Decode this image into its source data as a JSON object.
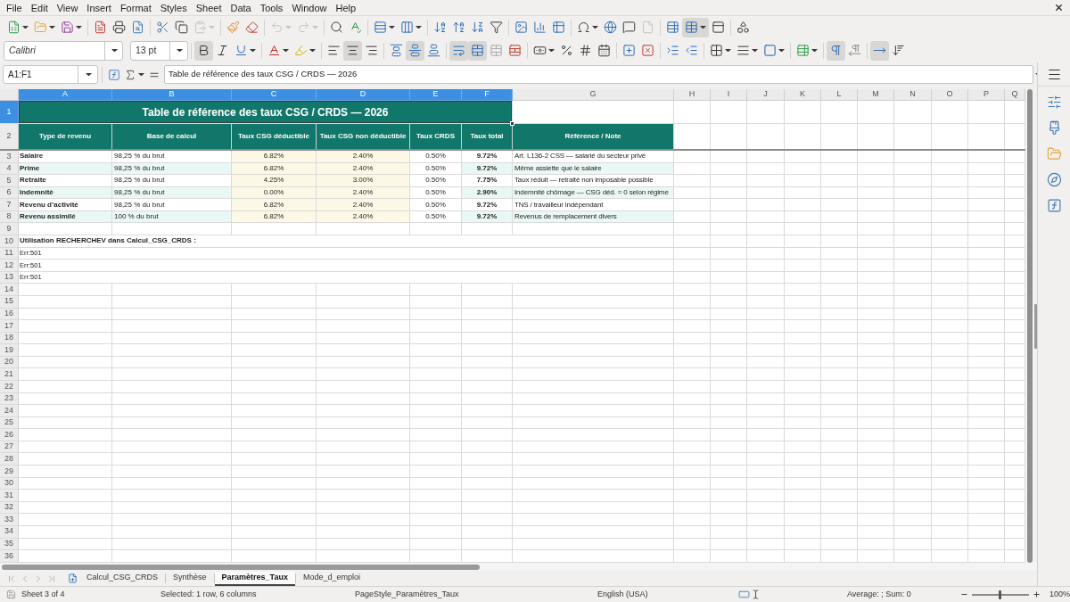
{
  "menu_bar": {
    "items": [
      "File",
      "Edit",
      "View",
      "Insert",
      "Format",
      "Styles",
      "Sheet",
      "Data",
      "Tools",
      "Window",
      "Help"
    ]
  },
  "standard_toolbar": {
    "buttons": [
      {
        "pressed": false,
        "disabled": false
      },
      {
        "pressed": false,
        "disabled": false
      },
      {
        "pressed": false,
        "disabled": false
      },
      {
        "pressed": false,
        "disabled": false
      },
      {
        "pressed": false,
        "disabled": false
      },
      {
        "pressed": false,
        "disabled": false
      },
      {
        "pressed": false,
        "disabled": false
      },
      {
        "pressed": false,
        "disabled": false
      },
      {
        "pressed": false,
        "disabled": true
      },
      {
        "pressed": false,
        "disabled": false
      },
      {
        "pressed": false,
        "disabled": false
      },
      {
        "pressed": false,
        "disabled": true
      },
      {
        "pressed": false,
        "disabled": true
      },
      {
        "pressed": false,
        "disabled": false
      },
      {
        "pressed": false,
        "disabled": false
      },
      {
        "pressed": false,
        "disabled": false
      },
      {
        "pressed": false,
        "disabled": false
      },
      {
        "pressed": false,
        "disabled": false
      },
      {
        "pressed": false,
        "disabled": false
      },
      {
        "pressed": false,
        "disabled": false
      },
      {
        "pressed": false,
        "disabled": false
      },
      {
        "pressed": false,
        "disabled": false
      },
      {
        "pressed": false,
        "disabled": false
      },
      {
        "pressed": false,
        "disabled": false
      },
      {
        "pressed": false,
        "disabled": false
      },
      {
        "pressed": false,
        "disabled": false
      },
      {
        "pressed": false,
        "disabled": false
      },
      {
        "pressed": false,
        "disabled": true
      },
      {
        "pressed": false,
        "disabled": false
      },
      {
        "pressed": true,
        "disabled": false
      },
      {
        "pressed": false,
        "disabled": false
      },
      {
        "pressed": false,
        "disabled": false
      }
    ]
  },
  "formatting_toolbar": {
    "font_name": "Calibri",
    "font_size": "13 pt",
    "buttons": [
      {
        "pressed": true
      },
      {
        "pressed": false
      },
      {
        "pressed": false
      },
      {
        "pressed": false
      },
      {
        "pressed": false
      },
      {
        "pressed": false
      },
      {
        "pressed": true
      },
      {
        "pressed": false
      },
      {
        "pressed": false
      },
      {
        "pressed": true
      },
      {
        "pressed": false
      },
      {
        "pressed": true
      },
      {
        "pressed": true
      },
      {
        "pressed": false
      },
      {
        "pressed": false
      },
      {
        "pressed": false
      },
      {
        "pressed": false
      },
      {
        "pressed": false
      },
      {
        "pressed": false
      },
      {
        "pressed": false
      },
      {
        "pressed": false
      },
      {
        "pressed": false
      },
      {
        "pressed": false
      },
      {
        "pressed": false
      },
      {
        "pressed": false
      },
      {
        "pressed": false
      },
      {
        "pressed": false
      },
      {
        "pressed": true
      },
      {
        "pressed": false
      },
      {
        "pressed": true
      },
      {
        "pressed": false
      }
    ]
  },
  "formula_bar": {
    "cell_reference": "A1:F1",
    "content": "Table de référence des taux CSG / CRDS — 2026"
  },
  "sheet": {
    "columns": [
      {
        "label": "A",
        "selected": true
      },
      {
        "label": "B",
        "selected": true
      },
      {
        "label": "C",
        "selected": true
      },
      {
        "label": "D",
        "selected": true
      },
      {
        "label": "E",
        "selected": true
      },
      {
        "label": "F",
        "selected": true
      },
      {
        "label": "G",
        "selected": false
      },
      {
        "label": "H",
        "selected": false
      },
      {
        "label": "I",
        "selected": false
      },
      {
        "label": "J",
        "selected": false
      },
      {
        "label": "K",
        "selected": false
      },
      {
        "label": "L",
        "selected": false
      },
      {
        "label": "M",
        "selected": false
      },
      {
        "label": "N",
        "selected": false
      },
      {
        "label": "O",
        "selected": false
      },
      {
        "label": "P",
        "selected": false
      },
      {
        "label": "Q",
        "selected": false
      }
    ],
    "rows": [
      {
        "label": "1",
        "selected": true
      },
      {
        "label": "2",
        "selected": false
      },
      {
        "label": "3",
        "selected": false
      },
      {
        "label": "4",
        "selected": false
      },
      {
        "label": "5",
        "selected": false
      },
      {
        "label": "6",
        "selected": false
      },
      {
        "label": "7",
        "selected": false
      },
      {
        "label": "8",
        "selected": false
      },
      {
        "label": "9",
        "selected": false
      },
      {
        "label": "10",
        "selected": false
      },
      {
        "label": "11",
        "selected": false
      },
      {
        "label": "12",
        "selected": false
      },
      {
        "label": "13",
        "selected": false
      },
      {
        "label": "14",
        "selected": false
      },
      {
        "label": "15",
        "selected": false
      },
      {
        "label": "16",
        "selected": false
      },
      {
        "label": "17",
        "selected": false
      },
      {
        "label": "18",
        "selected": false
      },
      {
        "label": "19",
        "selected": false
      },
      {
        "label": "20",
        "selected": false
      },
      {
        "label": "21",
        "selected": false
      },
      {
        "label": "22",
        "selected": false
      },
      {
        "label": "23",
        "selected": false
      },
      {
        "label": "24",
        "selected": false
      },
      {
        "label": "25",
        "selected": false
      },
      {
        "label": "26",
        "selected": false
      },
      {
        "label": "27",
        "selected": false
      },
      {
        "label": "28",
        "selected": false
      },
      {
        "label": "29",
        "selected": false
      },
      {
        "label": "30",
        "selected": false
      },
      {
        "label": "31",
        "selected": false
      },
      {
        "label": "32",
        "selected": false
      },
      {
        "label": "33",
        "selected": false
      },
      {
        "label": "34",
        "selected": false
      },
      {
        "label": "35",
        "selected": false
      },
      {
        "label": "36",
        "selected": false
      }
    ],
    "title": "Table de référence des taux CSG / CRDS — 2026",
    "table": {
      "headers": [
        "Type de revenu",
        "Base de calcul",
        "Taux CSG déductible",
        "Taux CSG non déductible",
        "Taux CRDS",
        "Taux total",
        "Référence / Note"
      ],
      "rows": [
        {
          "cells": [
            "Salaire",
            "98,25 % du brut",
            "6.82%",
            "2.40%",
            "0.50%",
            "9.72%",
            "Art. L136-2 CSS — salarié du secteur privé"
          ]
        },
        {
          "cells": [
            "Prime",
            "98,25 % du brut",
            "6.82%",
            "2.40%",
            "0.50%",
            "9.72%",
            "Même assiette que le salaire"
          ]
        },
        {
          "cells": [
            "Retraite",
            "98,25 % du brut",
            "4.25%",
            "3.00%",
            "0.50%",
            "7.75%",
            "Taux réduit — retraité non imposable possible"
          ]
        },
        {
          "cells": [
            "Indemnité",
            "98,25 % du brut",
            "0.00%",
            "2.40%",
            "0.50%",
            "2.90%",
            "Indemnité chômage — CSG déd. = 0 selon régime"
          ]
        },
        {
          "cells": [
            "Revenu d’activité",
            "98,25 % du brut",
            "6.82%",
            "2.40%",
            "0.50%",
            "9.72%",
            "TNS / travailleur indépendant"
          ]
        },
        {
          "cells": [
            "Revenu assimilé",
            "100 % du brut",
            "6.82%",
            "2.40%",
            "0.50%",
            "9.72%",
            "Revenus de remplacement divers"
          ]
        }
      ]
    },
    "lookup": {
      "label": "Utilisation RECHERCHEV dans Calcul_CSG_CRDS :",
      "results": [
        "Err:501",
        "Err:501",
        "Err:501"
      ]
    }
  },
  "sheet_tabs": [
    {
      "label": "Calcul_CSG_CRDS",
      "selected": false
    },
    {
      "label": "Synthèse",
      "selected": false
    },
    {
      "label": "Paramètres_Taux",
      "selected": true
    },
    {
      "label": "Mode_d_emploi",
      "selected": false
    }
  ],
  "status_bar": {
    "sheet_position": "Sheet 3 of 4",
    "selection": "Selected: 1 row, 6 columns",
    "page_style": "PageStyle_Paramètres_Taux",
    "language": "English (USA)",
    "summary": "Average: ; Sum: 0",
    "zoom": {
      "level": 0.5,
      "reading": "100%"
    }
  }
}
